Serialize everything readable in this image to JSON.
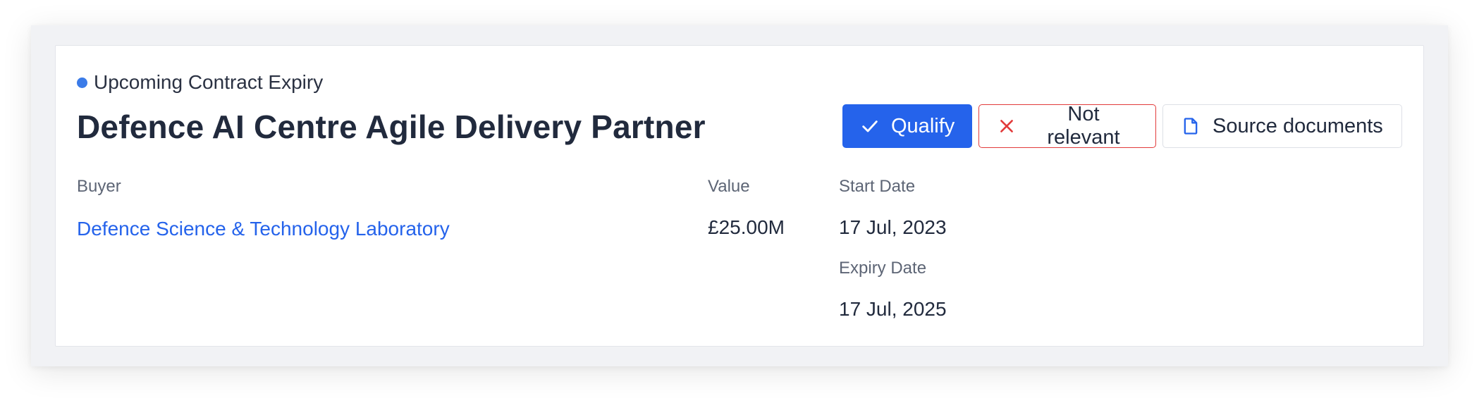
{
  "card": {
    "status_label": "Upcoming Contract Expiry",
    "status_color": "#3b7be8",
    "title": "Defence AI Centre Agile Delivery Partner",
    "actions": {
      "qualify_label": "Qualify",
      "not_relevant_label": "Not relevant",
      "source_documents_label": "Source documents"
    },
    "buyer": {
      "label": "Buyer",
      "value": "Defence Science & Technology Laboratory"
    },
    "contract_value": {
      "label": "Value",
      "value": "£25.00M"
    },
    "start_date": {
      "label": "Start Date",
      "value": "17 Jul, 2023"
    },
    "expiry_date": {
      "label": "Expiry Date",
      "value": "17 Jul, 2025"
    }
  },
  "colors": {
    "primary": "#2563eb",
    "danger": "#e23b3b",
    "text": "#212a3d",
    "muted": "#5d6575"
  },
  "icons": {
    "qualify": "check-icon",
    "not_relevant": "close-icon",
    "source_documents": "document-icon"
  }
}
